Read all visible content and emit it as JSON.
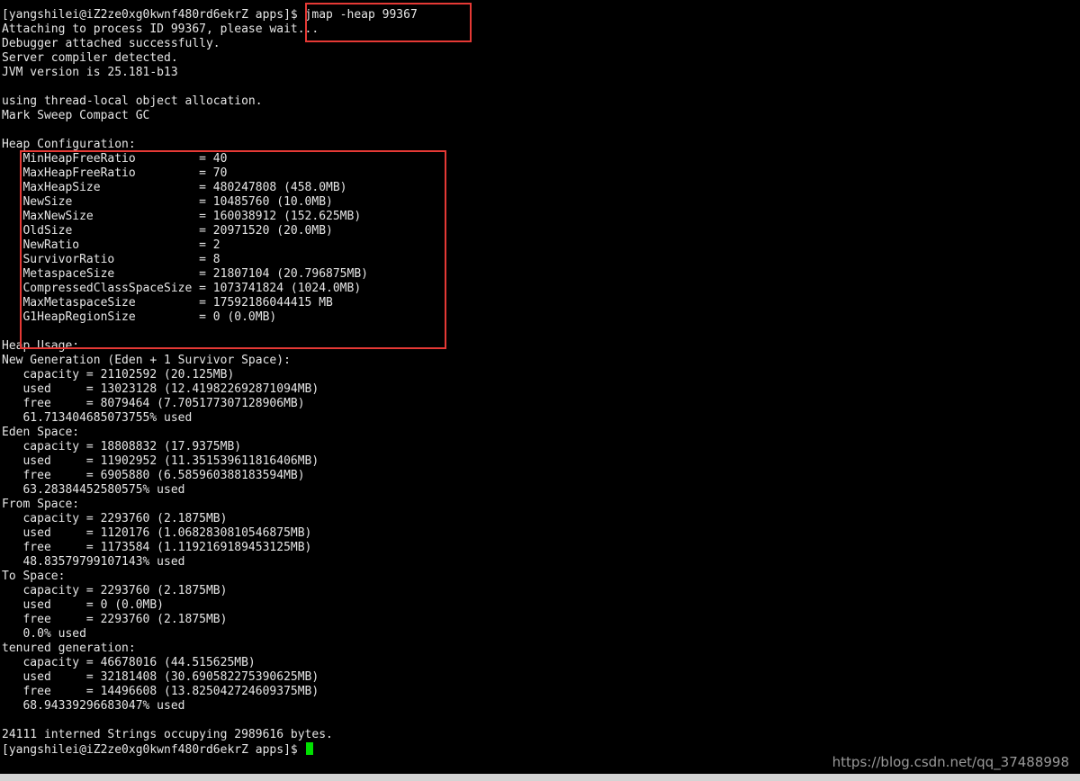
{
  "terminal": {
    "lines": [
      "[yangshilei@iZ2ze0xg0kwnf480rd6ekrZ apps]$ jmap -heap 99367",
      "Attaching to process ID 99367, please wait...",
      "Debugger attached successfully.",
      "Server compiler detected.",
      "JVM version is 25.181-b13",
      "",
      "using thread-local object allocation.",
      "Mark Sweep Compact GC",
      "",
      "Heap Configuration:",
      "   MinHeapFreeRatio         = 40",
      "   MaxHeapFreeRatio         = 70",
      "   MaxHeapSize              = 480247808 (458.0MB)",
      "   NewSize                  = 10485760 (10.0MB)",
      "   MaxNewSize               = 160038912 (152.625MB)",
      "   OldSize                  = 20971520 (20.0MB)",
      "   NewRatio                 = 2",
      "   SurvivorRatio            = 8",
      "   MetaspaceSize            = 21807104 (20.796875MB)",
      "   CompressedClassSpaceSize = 1073741824 (1024.0MB)",
      "   MaxMetaspaceSize         = 17592186044415 MB",
      "   G1HeapRegionSize         = 0 (0.0MB)",
      "",
      "Heap Usage:",
      "New Generation (Eden + 1 Survivor Space):",
      "   capacity = 21102592 (20.125MB)",
      "   used     = 13023128 (12.419822692871094MB)",
      "   free     = 8079464 (7.705177307128906MB)",
      "   61.713404685073755% used",
      "Eden Space:",
      "   capacity = 18808832 (17.9375MB)",
      "   used     = 11902952 (11.351539611816406MB)",
      "   free     = 6905880 (6.585960388183594MB)",
      "   63.28384452580575% used",
      "From Space:",
      "   capacity = 2293760 (2.1875MB)",
      "   used     = 1120176 (1.0682830810546875MB)",
      "   free     = 1173584 (1.1192169189453125MB)",
      "   48.83579799107143% used",
      "To Space:",
      "   capacity = 2293760 (2.1875MB)",
      "   used     = 0 (0.0MB)",
      "   free     = 2293760 (2.1875MB)",
      "   0.0% used",
      "tenured generation:",
      "   capacity = 46678016 (44.515625MB)",
      "   used     = 32181408 (30.690582275390625MB)",
      "   free     = 14496608 (13.825042724609375MB)",
      "   68.94339296683047% used",
      "",
      "24111 interned Strings occupying 2989616 bytes.",
      "[yangshilei@iZ2ze0xg0kwnf480rd6ekrZ apps]$ "
    ]
  },
  "watermark": "https://blog.csdn.net/qq_37488998",
  "colors": {
    "background": "#000000",
    "text": "#e6e6e6",
    "highlight_box": "#e53935",
    "cursor": "#00e000"
  }
}
